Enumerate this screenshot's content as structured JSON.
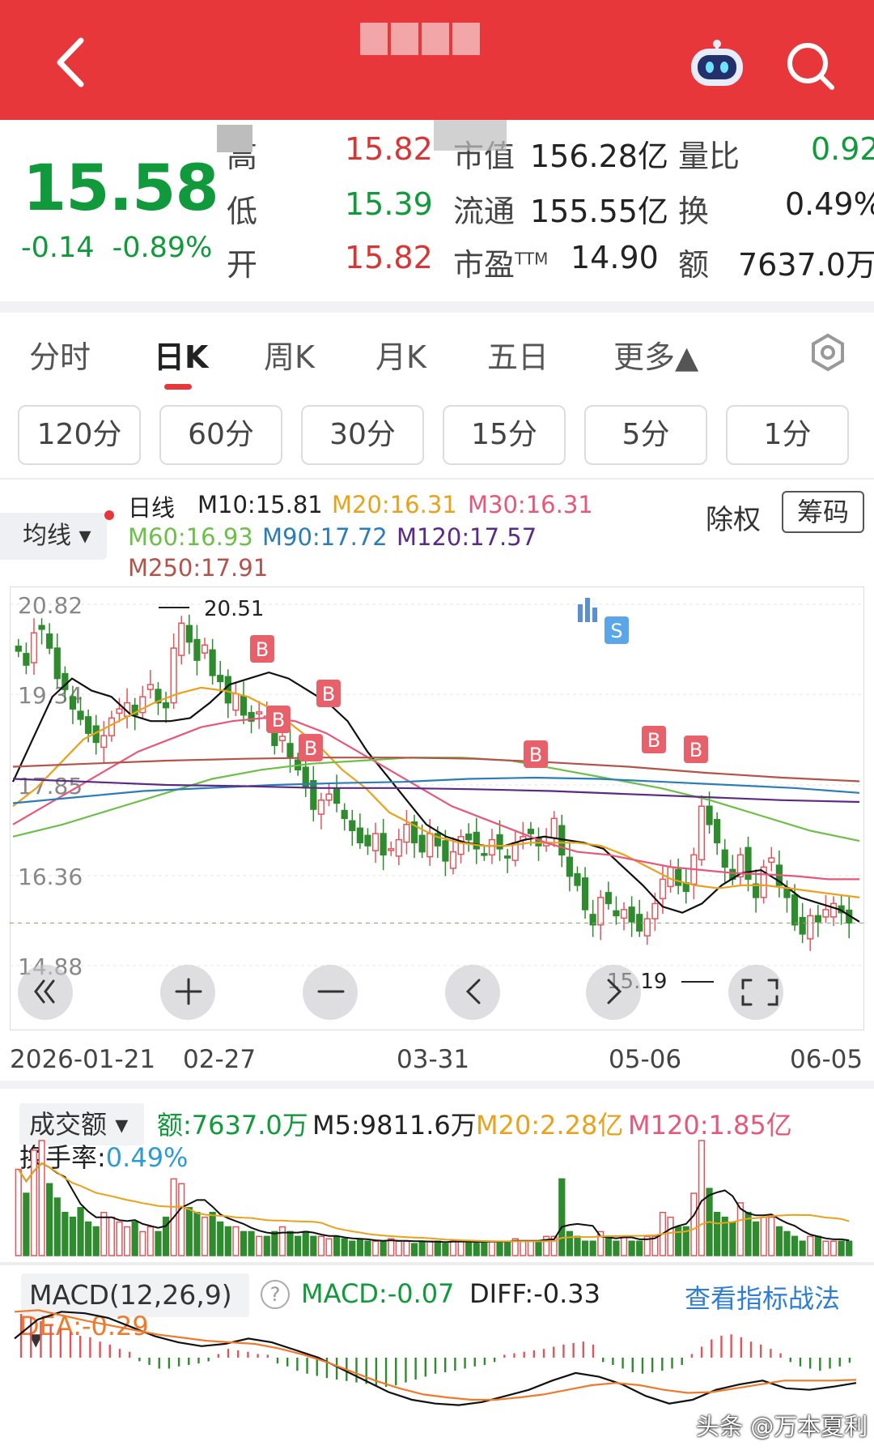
{
  "header": {
    "back_icon": "chevron-left-icon",
    "assistant_icon": "robot-icon",
    "search_icon": "search-icon",
    "bg_color": "#e8373b"
  },
  "quote": {
    "price": "15.58",
    "change": "-0.14",
    "change_pct": "-0.89%",
    "high_label": "高",
    "high_value": "15.82",
    "low_label": "低",
    "low_value": "15.39",
    "open_label": "开",
    "open_value": "15.82",
    "mcap_label": "市值",
    "mcap_value": "156.28亿",
    "float_label": "流通",
    "float_value": "155.55亿",
    "pe_label": "市盈",
    "pe_sup": "TTM",
    "pe_value": "14.90",
    "vol_ratio_label": "量比",
    "vol_ratio_value": "0.92",
    "turnover_label": "换",
    "turnover_value": "0.49%",
    "amount_label": "额",
    "amount_value": "7637.0万",
    "down_color": "#119a3b",
    "up_color": "#d93535"
  },
  "tabs": [
    {
      "label": "分时",
      "active": false
    },
    {
      "label": "日K",
      "active": true
    },
    {
      "label": "周K",
      "active": false
    },
    {
      "label": "月K",
      "active": false
    },
    {
      "label": "五日",
      "active": false
    },
    {
      "label": "更多▲",
      "active": false
    }
  ],
  "minute_buttons": [
    "120分",
    "60分",
    "30分",
    "15分",
    "5分",
    "1分"
  ],
  "ma_legend": {
    "selector": "均线 ▾",
    "line_label": "日线",
    "m10": "M10:15.81",
    "m20": "M20:16.31",
    "m30": "M30:16.31",
    "m60": "M60:16.93",
    "m90": "M90:17.72",
    "m120": "M120:17.57",
    "m250": "M250:17.91",
    "chuquan": "除权",
    "chouma": "筹码"
  },
  "chart_data": [
    {
      "type": "candlestick",
      "y_ticks": [
        "20.82",
        "19.34",
        "17.85",
        "16.36",
        "14.88"
      ],
      "ylim": [
        14.88,
        20.82
      ],
      "x_labels": [
        "2026-01-21",
        "02-27",
        "03-31",
        "05-06",
        "06-05"
      ],
      "high_mark": "20.51",
      "low_mark": "15.19",
      "signals": [
        "B",
        "B",
        "B",
        "B",
        "S",
        "B",
        "B",
        "B"
      ],
      "close": [
        20.05,
        19.82,
        20.35,
        20.41,
        20.1,
        19.6,
        19.42,
        19.1,
        18.93,
        18.7,
        18.55,
        18.66,
        18.95,
        19.1,
        19.2,
        19.0,
        19.3,
        19.5,
        19.2,
        19.12,
        20.1,
        20.51,
        20.2,
        19.9,
        20.15,
        19.65,
        19.55,
        19.2,
        19.35,
        19.0,
        18.9,
        19.05,
        18.98,
        18.5,
        18.65,
        18.3,
        18.1,
        17.8,
        17.45,
        17.6,
        17.7,
        17.55,
        17.3,
        17.1,
        16.9,
        16.85,
        17.05,
        16.7,
        16.8,
        16.95,
        17.2,
        16.9,
        16.75,
        17.05,
        16.85,
        16.6,
        16.75,
        17.0,
        16.95,
        16.8,
        16.7,
        16.95,
        16.8,
        16.65,
        16.9,
        17.0,
        17.05,
        16.85,
        16.9,
        17.3,
        16.7,
        16.35,
        16.2,
        15.8,
        15.55,
        16.0,
        15.9,
        15.7,
        15.8,
        15.6,
        15.45,
        15.65,
        15.9,
        16.3,
        16.5,
        16.2,
        16.1,
        16.7,
        17.5,
        17.2,
        16.9,
        16.5,
        16.3,
        16.7,
        16.3,
        16.0,
        16.5,
        16.65,
        16.2,
        16.0,
        15.55,
        15.4,
        15.7,
        15.6,
        15.8,
        15.9,
        15.75,
        15.58
      ],
      "ma_lines": [
        {
          "name": "M10",
          "color": "#111111",
          "values": [
            17.9,
            18.6,
            19.3,
            19.6,
            19.4,
            19.3,
            19.0,
            18.9,
            18.9,
            18.95,
            19.2,
            19.5,
            19.6,
            19.7,
            19.6,
            19.4,
            19.2,
            18.9,
            18.4,
            18.0,
            17.6,
            17.2,
            17.0,
            16.9,
            16.85,
            16.85,
            16.95,
            17.0,
            16.95,
            16.9,
            16.8,
            16.5,
            16.2,
            15.85,
            15.75,
            15.9,
            16.2,
            16.4,
            16.45,
            16.25,
            16.0,
            15.9,
            15.8,
            15.6
          ]
        },
        {
          "name": "M20",
          "color": "#e9a21c",
          "values": [
            17.5,
            17.8,
            18.2,
            18.6,
            18.8,
            19.0,
            19.2,
            19.35,
            19.45,
            19.4,
            19.3,
            19.1,
            18.8,
            18.5,
            18.1,
            17.8,
            17.4,
            17.2,
            17.0,
            16.9,
            16.85,
            16.85,
            16.9,
            16.9,
            16.9,
            16.85,
            16.7,
            16.5,
            16.3,
            16.2,
            16.15,
            16.2,
            16.2,
            16.15,
            16.1,
            16.05,
            16.0
          ]
        },
        {
          "name": "M30",
          "color": "#e8577a",
          "values": [
            17.2,
            17.5,
            17.8,
            18.1,
            18.4,
            18.6,
            18.8,
            18.9,
            18.95,
            18.9,
            18.7,
            18.4,
            18.1,
            17.8,
            17.5,
            17.3,
            17.1,
            16.9,
            16.75,
            16.7,
            16.6,
            16.5,
            16.45,
            16.4,
            16.38,
            16.35,
            16.3,
            16.3
          ]
        },
        {
          "name": "M60",
          "color": "#6cc048",
          "values": [
            17.0,
            17.2,
            17.45,
            17.7,
            17.95,
            18.1,
            18.2,
            18.25,
            18.3,
            18.3,
            18.25,
            18.1,
            17.95,
            17.8,
            17.6,
            17.35,
            17.1,
            16.93
          ]
        },
        {
          "name": "M90",
          "color": "#2b7db8",
          "values": [
            17.55,
            17.65,
            17.75,
            17.8,
            17.85,
            17.88,
            17.9,
            17.95,
            17.97,
            17.95,
            17.9,
            17.85,
            17.8,
            17.72
          ]
        },
        {
          "name": "M120",
          "color": "#5b2a86",
          "values": [
            17.95,
            17.9,
            17.85,
            17.83,
            17.8,
            17.8,
            17.78,
            17.75,
            17.7,
            17.65,
            17.6,
            17.57
          ]
        },
        {
          "name": "M250",
          "color": "#b5524a",
          "values": [
            18.15,
            18.2,
            18.25,
            18.28,
            18.3,
            18.3,
            18.28,
            18.22,
            18.15,
            18.05,
            17.97,
            17.91
          ]
        }
      ]
    },
    {
      "type": "bar",
      "title": "成交额",
      "amount": "额:7637.0万",
      "m5": "M5:9811.6万",
      "m20": "M20:2.28亿",
      "m120": "M120:1.85亿",
      "turnover_label": "换手率:",
      "turnover_value": "0.49%",
      "values": [
        1.8,
        1.3,
        2.2,
        2.4,
        1.5,
        1.2,
        0.9,
        0.8,
        1.0,
        0.7,
        0.6,
        0.9,
        0.8,
        0.7,
        0.6,
        0.7,
        0.5,
        0.6,
        0.5,
        0.8,
        1.6,
        1.5,
        1.0,
        0.9,
        0.8,
        0.9,
        0.7,
        0.6,
        0.6,
        0.5,
        0.5,
        0.4,
        0.4,
        0.5,
        0.6,
        0.5,
        0.4,
        0.5,
        0.4,
        0.4,
        0.35,
        0.4,
        0.35,
        0.3,
        0.35,
        0.3,
        0.3,
        0.3,
        0.35,
        0.3,
        0.3,
        0.25,
        0.3,
        0.3,
        0.3,
        0.25,
        0.3,
        0.3,
        0.3,
        0.25,
        0.3,
        0.3,
        0.3,
        0.3,
        0.35,
        0.3,
        0.3,
        0.3,
        0.4,
        0.4,
        1.6,
        0.5,
        0.4,
        0.3,
        0.3,
        0.5,
        0.4,
        0.3,
        0.4,
        0.3,
        0.3,
        0.4,
        0.4,
        0.9,
        0.8,
        0.6,
        0.6,
        1.3,
        2.4,
        1.4,
        0.9,
        0.8,
        0.7,
        1.1,
        0.9,
        0.7,
        0.8,
        0.8,
        0.6,
        0.5,
        0.4,
        0.3,
        0.4,
        0.4,
        0.3,
        0.3,
        0.3,
        0.3
      ]
    },
    {
      "type": "bar",
      "title": "MACD(12,26,9)",
      "macd": "MACD:-0.07",
      "diff": "DIFF:-0.33",
      "dea": "DEA:-0.29",
      "link": "查看指标战法",
      "hist": [
        0.6,
        0.55,
        0.5,
        0.45,
        0.4,
        0.35,
        0.3,
        0.28,
        0.22,
        0.18,
        0.12,
        0.08,
        -0.05,
        -0.1,
        -0.15,
        -0.15,
        -0.12,
        -0.1,
        -0.08,
        -0.05,
        0.05,
        0.12,
        0.1,
        0.08,
        0.05,
        0.04,
        -0.08,
        -0.12,
        -0.18,
        -0.22,
        -0.25,
        -0.28,
        -0.3,
        -0.32,
        -0.34,
        -0.36,
        -0.38,
        -0.4,
        -0.38,
        -0.34,
        -0.3,
        -0.26,
        -0.22,
        -0.2,
        -0.18,
        -0.15,
        -0.12,
        -0.1,
        -0.06,
        0.04,
        0.06,
        0.08,
        0.1,
        0.12,
        0.15,
        0.18,
        0.2,
        0.22,
        0.18,
        -0.06,
        -0.1,
        -0.15,
        -0.2,
        -0.22,
        -0.2,
        -0.18,
        -0.15,
        -0.1,
        0.05,
        0.15,
        0.25,
        0.3,
        0.32,
        0.28,
        0.22,
        0.18,
        0.12,
        0.06,
        -0.06,
        -0.12,
        -0.15,
        -0.18,
        -0.15,
        -0.12,
        -0.07
      ],
      "diff_line": [
        0.25,
        0.5,
        0.6,
        0.58,
        0.52,
        0.4,
        0.28,
        0.2,
        0.15,
        0.18,
        0.25,
        0.2,
        0.1,
        0.0,
        -0.15,
        -0.3,
        -0.45,
        -0.55,
        -0.6,
        -0.62,
        -0.58,
        -0.5,
        -0.42,
        -0.3,
        -0.2,
        -0.25,
        -0.35,
        -0.5,
        -0.6,
        -0.55,
        -0.42,
        -0.35,
        -0.3,
        -0.4,
        -0.42,
        -0.38,
        -0.33
      ],
      "dea_line": [
        0.6,
        0.62,
        0.55,
        0.48,
        0.42,
        0.36,
        0.3,
        0.26,
        0.22,
        0.2,
        0.18,
        0.12,
        0.04,
        -0.06,
        -0.18,
        -0.3,
        -0.4,
        -0.48,
        -0.52,
        -0.55,
        -0.55,
        -0.52,
        -0.48,
        -0.42,
        -0.36,
        -0.33,
        -0.36,
        -0.42,
        -0.46,
        -0.45,
        -0.4,
        -0.35,
        -0.3,
        -0.3,
        -0.3,
        -0.29
      ]
    }
  ],
  "watermark": "头条 @万本夏利"
}
